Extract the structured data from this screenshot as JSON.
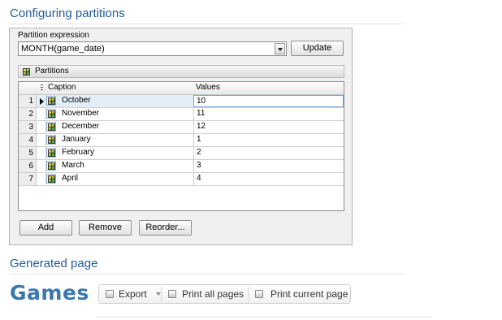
{
  "sections": {
    "configuring_title": "Configuring partitions",
    "generated_title": "Generated page"
  },
  "form": {
    "expression_label": "Partition expression",
    "expression_value": "MONTH(game_date)",
    "update_label": "Update",
    "partitions_title": "Partitions"
  },
  "grid": {
    "headers": {
      "caption": "Caption",
      "values": "Values"
    },
    "rows": [
      {
        "num": "1",
        "caption": "October",
        "value": "10"
      },
      {
        "num": "2",
        "caption": "November",
        "value": "11"
      },
      {
        "num": "3",
        "caption": "December",
        "value": "12"
      },
      {
        "num": "4",
        "caption": "January",
        "value": "1"
      },
      {
        "num": "5",
        "caption": "February",
        "value": "2"
      },
      {
        "num": "6",
        "caption": "March",
        "value": "3"
      },
      {
        "num": "7",
        "caption": "April",
        "value": "4"
      }
    ]
  },
  "buttons": {
    "add": "Add",
    "remove": "Remove",
    "reorder": "Reorder..."
  },
  "generated": {
    "title": "Games",
    "toolbar": {
      "export": "Export",
      "print_all": "Print all pages",
      "print_current": "Print current page"
    }
  }
}
